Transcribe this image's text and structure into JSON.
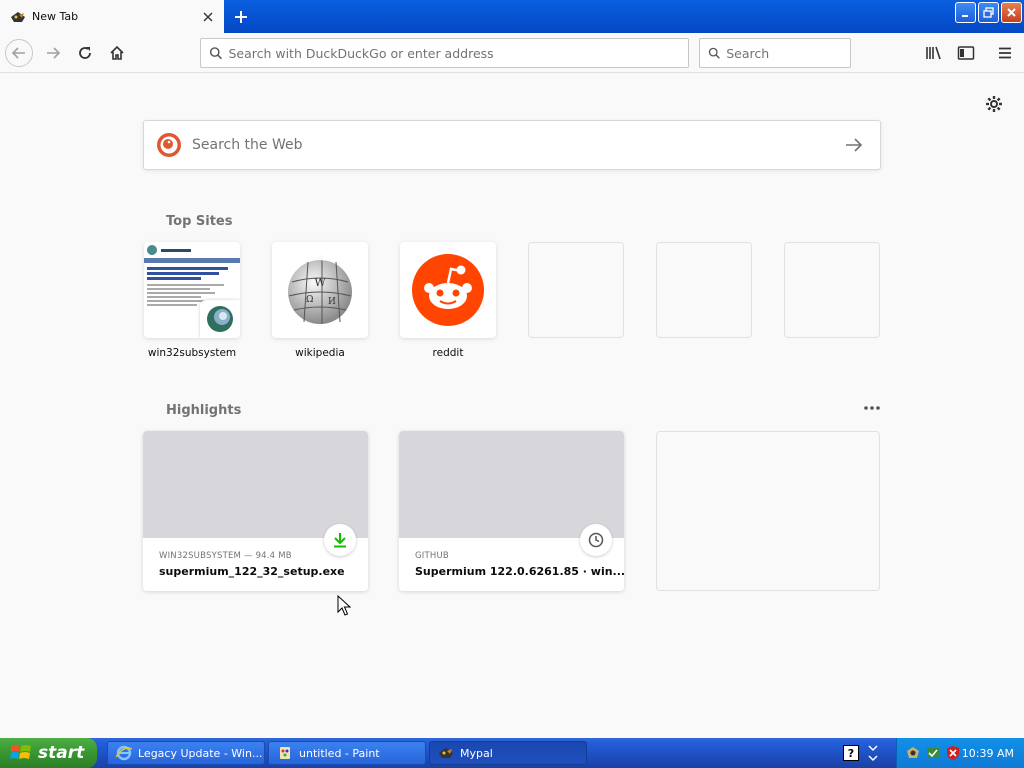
{
  "tab": {
    "title": "New Tab"
  },
  "urlbar": {
    "placeholder": "Search with DuckDuckGo or enter address"
  },
  "searchbar": {
    "placeholder": "Search"
  },
  "websearch": {
    "placeholder": "Search the Web"
  },
  "sections": {
    "top_sites": "Top Sites",
    "highlights": "Highlights"
  },
  "top_sites": [
    {
      "label": "win32subsystem"
    },
    {
      "label": "wikipedia"
    },
    {
      "label": "reddit"
    }
  ],
  "highlights": [
    {
      "context": "WIN32SUBSYSTEM — 94.4 MB",
      "title": "supermium_122_32_setup.exe",
      "badge": "download-icon"
    },
    {
      "context": "GITHUB",
      "title": "Supermium 122.0.6261.85 · win...",
      "badge": "clock-icon"
    }
  ],
  "taskbar": {
    "start": "start",
    "tasks": [
      {
        "label": "Legacy Update - Win..."
      },
      {
        "label": "untitled - Paint"
      },
      {
        "label": "Mypal"
      }
    ],
    "clock": "10:39 AM"
  },
  "colors": {
    "accent": "#0060df",
    "taskbar": "#245edb",
    "start": "#3c9a34",
    "reddit": "#ff4500"
  }
}
